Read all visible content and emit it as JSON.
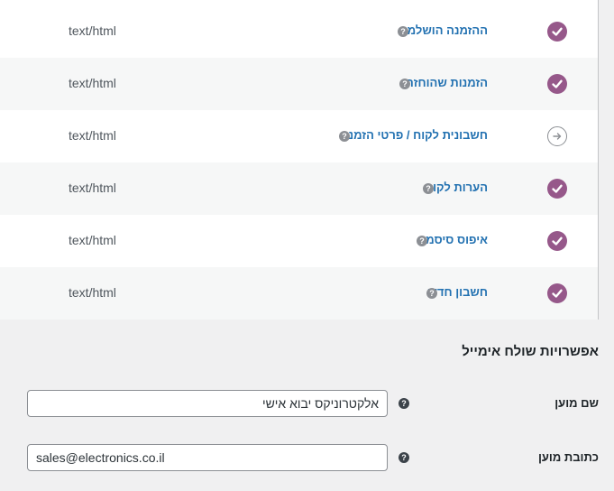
{
  "emails": [
    {
      "name": "ההזמנה הושלמה",
      "content_type": "text/html",
      "status": "enabled",
      "help": "?"
    },
    {
      "name": "הזמנות שהוחזרו",
      "content_type": "text/html",
      "status": "enabled",
      "help": "?"
    },
    {
      "name": "חשבונית לקוח / פרטי הזמנה",
      "content_type": "text/html",
      "status": "manual",
      "help": "?"
    },
    {
      "name": "הערות לקוח",
      "content_type": "text/html",
      "status": "enabled",
      "help": "?"
    },
    {
      "name": "איפוס סיסמה",
      "content_type": "text/html",
      "status": "enabled",
      "help": "?"
    },
    {
      "name": "חשבון חדש",
      "content_type": "text/html",
      "status": "enabled",
      "help": "?"
    }
  ],
  "sender_options": {
    "title": "אפשרויות שולח אימייל",
    "from_name": {
      "label": "שם מוען",
      "value": "אלקטרוניקס יבוא אישי",
      "help": "?"
    },
    "from_address": {
      "label": "כתובת מוען",
      "value": "sales@electronics.co.il",
      "help": "?"
    }
  },
  "colors": {
    "accent": "#96588a",
    "link": "#2271b1"
  }
}
